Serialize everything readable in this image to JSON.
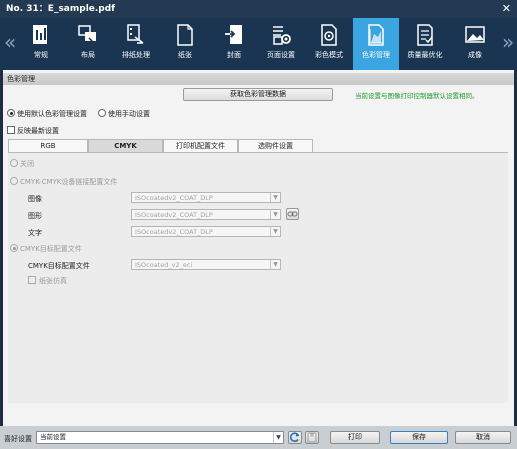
{
  "window": {
    "title": "No. 31：E_sample.pdf",
    "close_glyph": "✕"
  },
  "toolbar": {
    "prev_glyph": "«",
    "next_glyph": "»",
    "items": [
      {
        "label": "常规",
        "icon": "general-icon"
      },
      {
        "label": "布局",
        "icon": "layout-icon"
      },
      {
        "label": "排纸处理",
        "icon": "output-icon"
      },
      {
        "label": "纸张",
        "icon": "paper-icon"
      },
      {
        "label": "封面",
        "icon": "cover-icon"
      },
      {
        "label": "页面设置",
        "icon": "page-setting-icon"
      },
      {
        "label": "彩色模式",
        "icon": "color-mode-icon"
      },
      {
        "label": "色彩管理",
        "icon": "color-management-icon",
        "active": true
      },
      {
        "label": "质量最优化",
        "icon": "quality-icon"
      },
      {
        "label": "成像",
        "icon": "imaging-icon"
      }
    ],
    "active_color": "#3aa5e0"
  },
  "section": {
    "title": "色彩管理"
  },
  "get_data_button": "获取色彩管理数据",
  "note": "当前设置与图像打印控制器默认设置相同。",
  "radios": {
    "default_label": "使用默认色彩管理设置",
    "manual_label": "使用手动设置"
  },
  "reflect_label": "反映最新设置",
  "tabs": [
    "RGB",
    "CMYK",
    "打印机配置文件",
    "选购件设置"
  ],
  "cmyk": {
    "off_label": "关闭",
    "devicelink_label": "CMYK-CMYK设备链接配置文件",
    "image_label": "图像",
    "image_value": "ISOcoatedv2_COAT_DLP",
    "graphics_label": "图形",
    "graphics_value": "ISOcoatedv2_COAT_DLP",
    "text_label": "文字",
    "text_value": "ISOcoatedv2_COAT_DLP",
    "target_label": "CMYK目标配置文件",
    "target_profile_label": "CMYK目标配置文件",
    "target_profile_value": "ISOcoated_v2_eci",
    "paper_sim_label": "纸张仿真"
  },
  "bottom": {
    "fav_label": "喜好设置",
    "fav_value": "当前设置",
    "print_label": "打印",
    "save_label": "保存",
    "cancel_label": "取消"
  }
}
